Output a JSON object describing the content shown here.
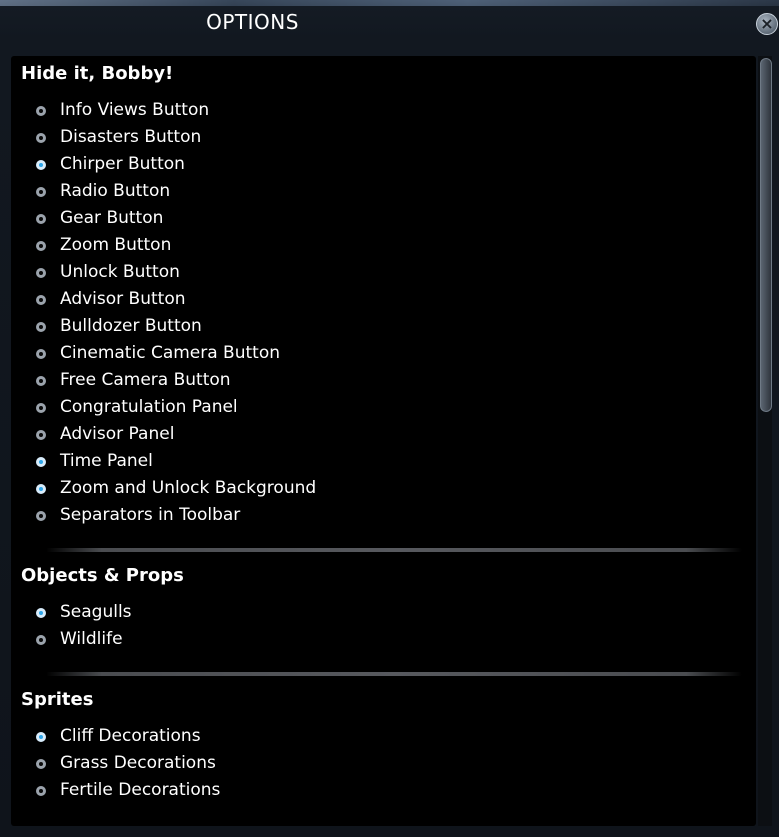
{
  "window": {
    "title": "OPTIONS",
    "close_icon": "×"
  },
  "sections": [
    {
      "title": "Hide it, Bobby!",
      "options": [
        {
          "label": "Info Views Button",
          "checked": false
        },
        {
          "label": "Disasters Button",
          "checked": false
        },
        {
          "label": "Chirper Button",
          "checked": true
        },
        {
          "label": "Radio Button",
          "checked": false
        },
        {
          "label": "Gear Button",
          "checked": false
        },
        {
          "label": "Zoom Button",
          "checked": false
        },
        {
          "label": "Unlock Button",
          "checked": false
        },
        {
          "label": "Advisor Button",
          "checked": false
        },
        {
          "label": "Bulldozer Button",
          "checked": false
        },
        {
          "label": "Cinematic Camera Button",
          "checked": false
        },
        {
          "label": "Free Camera Button",
          "checked": false
        },
        {
          "label": "Congratulation Panel",
          "checked": false
        },
        {
          "label": "Advisor Panel",
          "checked": false
        },
        {
          "label": "Time Panel",
          "checked": true
        },
        {
          "label": "Zoom and Unlock Background",
          "checked": true
        },
        {
          "label": "Separators in Toolbar",
          "checked": false
        }
      ]
    },
    {
      "title": "Objects & Props",
      "options": [
        {
          "label": "Seagulls",
          "checked": true
        },
        {
          "label": "Wildlife",
          "checked": false
        }
      ]
    },
    {
      "title": "Sprites",
      "options": [
        {
          "label": "Cliff Decorations",
          "checked": true
        },
        {
          "label": "Grass Decorations",
          "checked": false
        },
        {
          "label": "Fertile Decorations",
          "checked": false
        }
      ]
    }
  ],
  "colors": {
    "accent": "#2ea6ea",
    "panel": "#000000"
  }
}
